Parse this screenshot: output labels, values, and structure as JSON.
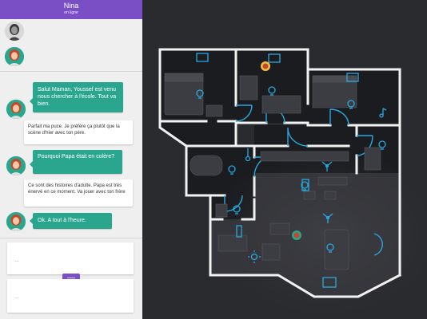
{
  "chat": {
    "contact_name": "Nina",
    "contact_status": "en ligne",
    "messages": [
      {
        "from": "me",
        "text": "Salut Maman, Youssef est venu nous chercher à l'école. Tout va bien."
      },
      {
        "from": "other",
        "text": "Parfait ma puce. Je préfère ça plutôt que la scène d'hier avec ton père."
      },
      {
        "from": "me",
        "text": "Pourquoi Papa était en colère?"
      },
      {
        "from": "other",
        "text": "Ce sont des histoires d'adulte. Papa est très énervé en ce moment. Va jouer avec ton frère"
      },
      {
        "from": "me",
        "text": "Ok. A tout à l'heure."
      }
    ],
    "composer_cards": [
      "...",
      "..."
    ]
  },
  "map": {
    "accent_color": "#29a8e0",
    "wall_color": "#f2f2f2"
  }
}
